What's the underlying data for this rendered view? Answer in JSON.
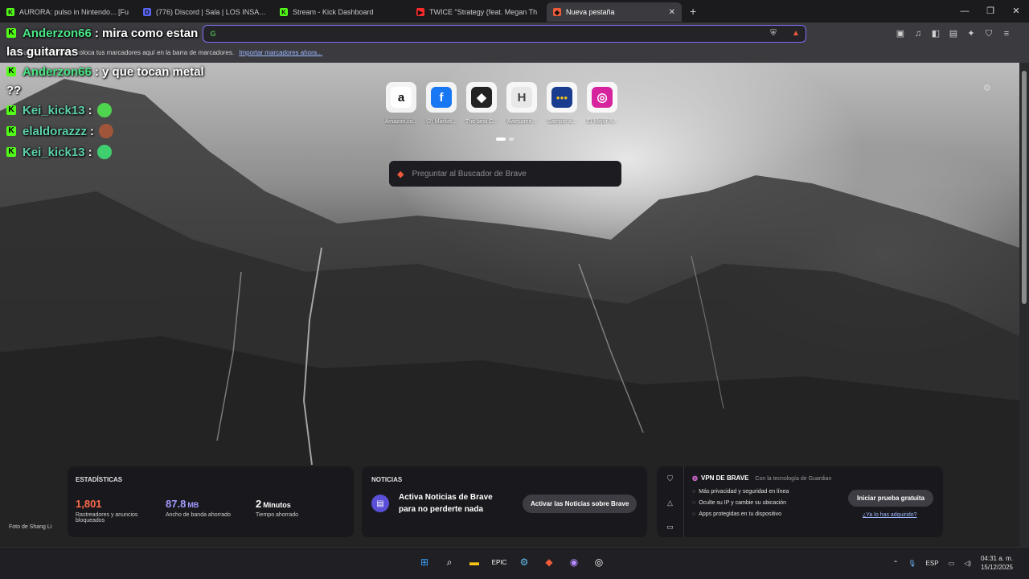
{
  "tabs": [
    {
      "title": "AURORA: pulso in Nintendo... [Fu",
      "fav": "K",
      "color": "#53fc18"
    },
    {
      "title": "(776) Discord | Sala | LOS INSANE",
      "fav": "D",
      "color": "#5865f2"
    },
    {
      "title": "Stream - Kick Dashboard",
      "fav": "K",
      "color": "#53fc18"
    },
    {
      "title": "TWICE \"Strategy (feat. Megan Th",
      "fav": "▶",
      "color": "#ff2b2b"
    },
    {
      "title": "Nueva pestaña",
      "fav": "◆",
      "color": "#f05a3b",
      "active": true
    }
  ],
  "omnibox": {
    "value": "",
    "placeholder": ""
  },
  "bookmarks": {
    "text": "Para un acceso rápido, coloca tus marcadores aquí en la barra de marcadores.",
    "link": "Importar marcadores ahora..."
  },
  "chat": [
    {
      "user": "Anderzon66",
      "msg": ": mira como estan",
      "wrap": "las guitarras",
      "style": "user"
    },
    {
      "user": "Anderzon66",
      "msg": ": y que tocan metal",
      "wrap": "??",
      "style": "user"
    },
    {
      "user": "Kei_kick13",
      "msg": ":",
      "emote": "#4fd44f",
      "style": "user2"
    },
    {
      "user": "elaldorazzz",
      "msg": ":",
      "emote": "#a0553a",
      "style": "user2"
    },
    {
      "user": "Kei_kick13",
      "msg": ":",
      "emote": "#3fcf6f",
      "style": "user2"
    }
  ],
  "top_sites": [
    {
      "label": "Amazon.co...",
      "glyph": "a",
      "fg": "#111",
      "bg": "#ffffff"
    },
    {
      "label": "(2) Market...",
      "glyph": "f",
      "fg": "#ffffff",
      "bg": "#1877f2"
    },
    {
      "label": "The best C...",
      "glyph": "◆",
      "fg": "#ffffff",
      "bg": "#222"
    },
    {
      "label": "Awesome...",
      "glyph": "H",
      "fg": "#444",
      "bg": "#e8e8e8"
    },
    {
      "label": "Sample a...",
      "glyph": "●●●",
      "fg": "#f5c518",
      "bg": "#1a3c8f"
    },
    {
      "label": "El Mejor A...",
      "glyph": "◎",
      "fg": "#ffffff",
      "bg": "#d6249f"
    }
  ],
  "search": {
    "placeholder": "Preguntar al Buscador de Brave"
  },
  "stats": {
    "header": "ESTADÍSTICAS",
    "items": [
      {
        "value": "1,801",
        "unit": "",
        "caption": "Rastreadores y anuncios bloqueados",
        "color": "#ff6a4d"
      },
      {
        "value": "87.8",
        "unit": "MB",
        "caption": "Ancho de banda ahorrado",
        "color": "#a29bff"
      },
      {
        "value": "2",
        "unit": "Minutos",
        "caption": "Tiempo ahorrado",
        "color": "#ffffff"
      }
    ]
  },
  "news": {
    "header": "NOTICIAS",
    "text": "Activa Noticias de Brave para no perderte nada",
    "button": "Activar las Noticias sobre Brave"
  },
  "vpn": {
    "title": "VPN DE BRAVE",
    "powered": "Con la tecnología de Guardian",
    "items": [
      "Más privacidad y seguridad en línea",
      "Oculte su IP y cambie su ubicación",
      "Apps protegidas en tu dispositivo"
    ],
    "trial": "Iniciar prueba gratuita",
    "already": "¿Ya lo has adquirido?"
  },
  "photo_credit": "Foto de Shang Li",
  "taskbar": {
    "lang": "ESP",
    "time": "04:31 a. m.",
    "date": "15/12/2025"
  }
}
